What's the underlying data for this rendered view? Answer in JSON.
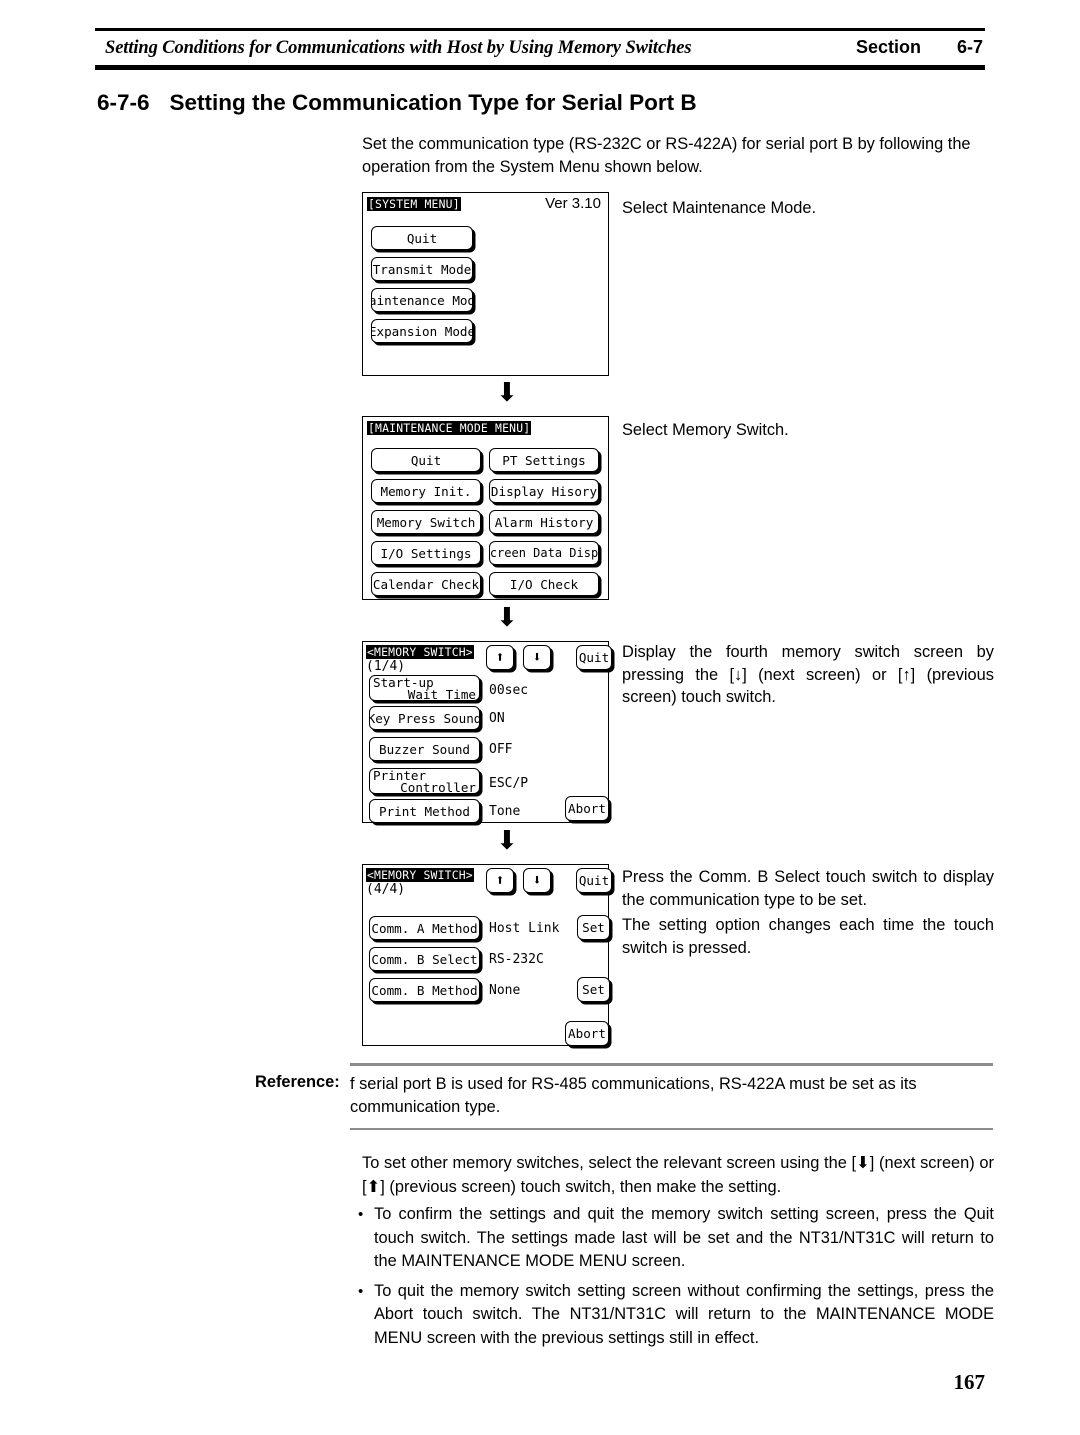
{
  "header": {
    "title": "Setting Conditions for Communications with Host by Using Memory Switches",
    "section_label": "Section",
    "section_number": "6-7"
  },
  "heading": {
    "number": "6-7-6",
    "text": "Setting the Communication Type for Serial Port B"
  },
  "intro": "Set the communication type (RS-232C or RS-422A) for serial port B by following the operation from the System Menu shown below.",
  "screens": {
    "system_menu": {
      "title": "[SYSTEM MENU]",
      "version": "Ver 3.10",
      "buttons": [
        "Quit",
        "Transmit Mode",
        "Maintenance Mode",
        "Expansion Mode"
      ]
    },
    "maintenance_menu": {
      "title": "[MAINTENANCE MODE MENU]",
      "left_buttons": [
        "Quit",
        "Memory Init.",
        "Memory Switch",
        "I/O Settings",
        "Calendar Check"
      ],
      "right_buttons": [
        "PT Settings",
        "Display Hisory",
        "Alarm History",
        "Screen Data Disp.",
        "I/O Check"
      ]
    },
    "memory_switch_1": {
      "title": "<MEMORY SWITCH>",
      "page": "(1/4)",
      "up_icon": "up-arrow-icon",
      "down_icon": "down-arrow-icon",
      "quit_label": "Quit",
      "abort_label": "Abort",
      "rows": [
        {
          "label_line1": "Start-up",
          "label_line2": "Wait Time",
          "value": "00sec"
        },
        {
          "label_line1": "Key Press Sound",
          "label_line2": "",
          "value": "ON"
        },
        {
          "label_line1": "Buzzer Sound",
          "label_line2": "",
          "value": "OFF"
        },
        {
          "label_line1": "Printer",
          "label_line2": "Controller",
          "value": "ESC/P"
        },
        {
          "label_line1": "Print Method",
          "label_line2": "",
          "value": "Tone"
        }
      ]
    },
    "memory_switch_4": {
      "title": "<MEMORY SWITCH>",
      "page": "(4/4)",
      "up_icon": "up-arrow-icon",
      "down_icon": "down-arrow-icon",
      "quit_label": "Quit",
      "abort_label": "Abort",
      "rows": [
        {
          "label": "Comm. A Method",
          "value": "Host Link",
          "set_label": "Set"
        },
        {
          "label": "Comm. B Select",
          "value": "RS-232C",
          "set_label": ""
        },
        {
          "label": "Comm. B Method",
          "value": "None",
          "set_label": "Set"
        }
      ]
    }
  },
  "notes": {
    "n1": "Select Maintenance Mode.",
    "n2": "Select Memory Switch.",
    "n3": "Display the fourth memory switch screen by pressing the [↓] (next screen) or [↑] (previous screen) touch switch.",
    "n4a": "Press the Comm. B Select touch switch to display the communication type to be set.",
    "n4b": "The setting option changes each time the touch switch is pressed."
  },
  "reference": {
    "label": "Reference:",
    "text": "f serial port B is used for RS-485 communications, RS-422A must be set as its communication type."
  },
  "closing": "To set other memory switches, select the relevant screen using the [⬇] (next screen) or [⬆] (previous screen) touch switch, then make the setting.",
  "bullets": [
    "To confirm the settings and quit the memory switch setting screen, press the Quit touch switch. The settings made last will be set and the NT31/NT31C will return to the MAINTENANCE MODE MENU screen.",
    "To quit the memory switch setting screen without confirming the settings, press the Abort touch switch. The NT31/NT31C will return to the MAINTENANCE MODE MENU screen with the previous settings still in effect."
  ],
  "bullet_marker": "•",
  "page_number": "167",
  "flow_arrow_glyph": "⬇"
}
